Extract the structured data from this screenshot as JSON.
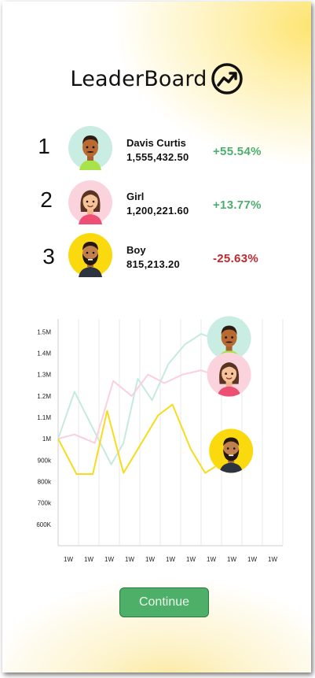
{
  "header": {
    "title": "LeaderBoard",
    "icon": "trending-up-icon"
  },
  "leaders": [
    {
      "rank": "1",
      "name": "Davis Curtis",
      "amount": "1,555,432.50",
      "change": "+55.54%",
      "change_color": "#4caf6e",
      "avatar_bg": "#c9ede3",
      "avatar": "man-avatar-icon"
    },
    {
      "rank": "2",
      "name": "Girl",
      "amount": "1,200,221.60",
      "change": "+13.77%",
      "change_color": "#4caf6e",
      "avatar_bg": "#fbd3dc",
      "avatar": "woman-avatar-icon"
    },
    {
      "rank": "3",
      "name": "Boy",
      "amount": "815,213.20",
      "change": "-25.63%",
      "change_color": "#c0282d",
      "avatar_bg": "#fbd90f",
      "avatar": "bearded-man-avatar-icon"
    }
  ],
  "chart_data": {
    "type": "line",
    "y_tick_labels": [
      "600K",
      "700k",
      "800k",
      "900k",
      "1M",
      "1.1M",
      "1.2M",
      "1.3M",
      "1.4M",
      "1.5M"
    ],
    "y_tick_values": [
      600000,
      700000,
      800000,
      900000,
      1000000,
      1100000,
      1200000,
      1300000,
      1400000,
      1500000
    ],
    "ylim": [
      500000,
      1560000
    ],
    "categories": [
      "1W",
      "1W",
      "1W",
      "1W",
      "1W",
      "1W",
      "1W",
      "1W",
      "1W",
      "1W",
      "1W"
    ],
    "grid": true,
    "series": [
      {
        "color": "#c5eade",
        "points": [
          [
            0,
            1000000
          ],
          [
            0.8,
            1220000
          ],
          [
            1.8,
            1030000
          ],
          [
            2.6,
            880000
          ],
          [
            3.2,
            980000
          ],
          [
            3.9,
            1280000
          ],
          [
            4.6,
            1180000
          ],
          [
            5.4,
            1350000
          ],
          [
            6.2,
            1440000
          ],
          [
            7.0,
            1490000
          ],
          [
            7.6,
            1470000
          ]
        ]
      },
      {
        "color": "#fbd0dd",
        "points": [
          [
            0,
            1000000
          ],
          [
            0.8,
            1020000
          ],
          [
            1.8,
            980000
          ],
          [
            2.7,
            1270000
          ],
          [
            3.6,
            1200000
          ],
          [
            4.4,
            1300000
          ],
          [
            5.2,
            1260000
          ],
          [
            6.1,
            1300000
          ],
          [
            7.0,
            1320000
          ],
          [
            7.6,
            1300000
          ]
        ]
      },
      {
        "color": "#f6dc1c",
        "points": [
          [
            0,
            1000000
          ],
          [
            0.9,
            835000
          ],
          [
            1.7,
            835000
          ],
          [
            2.4,
            1130000
          ],
          [
            3.2,
            840000
          ],
          [
            4.9,
            1110000
          ],
          [
            5.6,
            1160000
          ],
          [
            6.5,
            950000
          ],
          [
            7.2,
            840000
          ],
          [
            7.7,
            870000
          ]
        ]
      }
    ],
    "avatars": [
      {
        "avatar": "man-avatar-icon",
        "bg": "#c9ede3"
      },
      {
        "avatar": "woman-avatar-icon",
        "bg": "#fbd3dc"
      },
      {
        "avatar": "bearded-man-avatar-icon",
        "bg": "#fbd90f"
      }
    ]
  },
  "continue_button": {
    "label": "Continue",
    "color": "#4daf68"
  }
}
